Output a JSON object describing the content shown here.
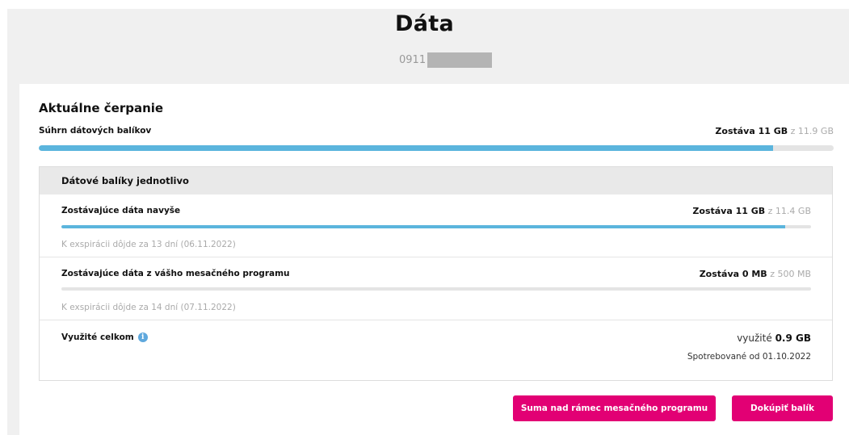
{
  "header": {
    "title": "Dáta",
    "msisdn_prefix": "0911"
  },
  "current_usage": {
    "title": "Aktuálne čerpanie",
    "summary": {
      "label": "Súhrn dátových balíkov",
      "remaining_text": "Zostáva 11 GB",
      "total_text": "z 11.9 GB",
      "remaining_fraction": 0.924
    }
  },
  "packages": {
    "header": "Dátové balíky jednotlivo",
    "items": [
      {
        "label": "Zostávajúce dáta navyše",
        "remaining_text": "Zostáva 11 GB",
        "total_text": "z 11.4 GB",
        "remaining_fraction": 0.965,
        "expiry": "K exspirácii dôjde za 13 dní (06.11.2022)"
      },
      {
        "label": "Zostávajúce dáta z vášho mesačného programu",
        "remaining_text": "Zostáva 0 MB",
        "total_text": "z 500 MB",
        "remaining_fraction": 0,
        "expiry": "K exspirácii dôjde za 14 dní (07.11.2022)"
      }
    ],
    "used_total": {
      "label": "Využité celkom",
      "info_icon": "info-icon",
      "used_prefix": "využité",
      "used_value": "0.9 GB",
      "since": "Spotrebované od 01.10.2022"
    }
  },
  "actions": {
    "sum_over_label": "Suma nad rámec mesačného programu",
    "buy_label": "Dokúpiť balík"
  },
  "colors": {
    "accent": "#e20074",
    "bar": "#5bb5dd",
    "info": "#5fa8dd"
  }
}
